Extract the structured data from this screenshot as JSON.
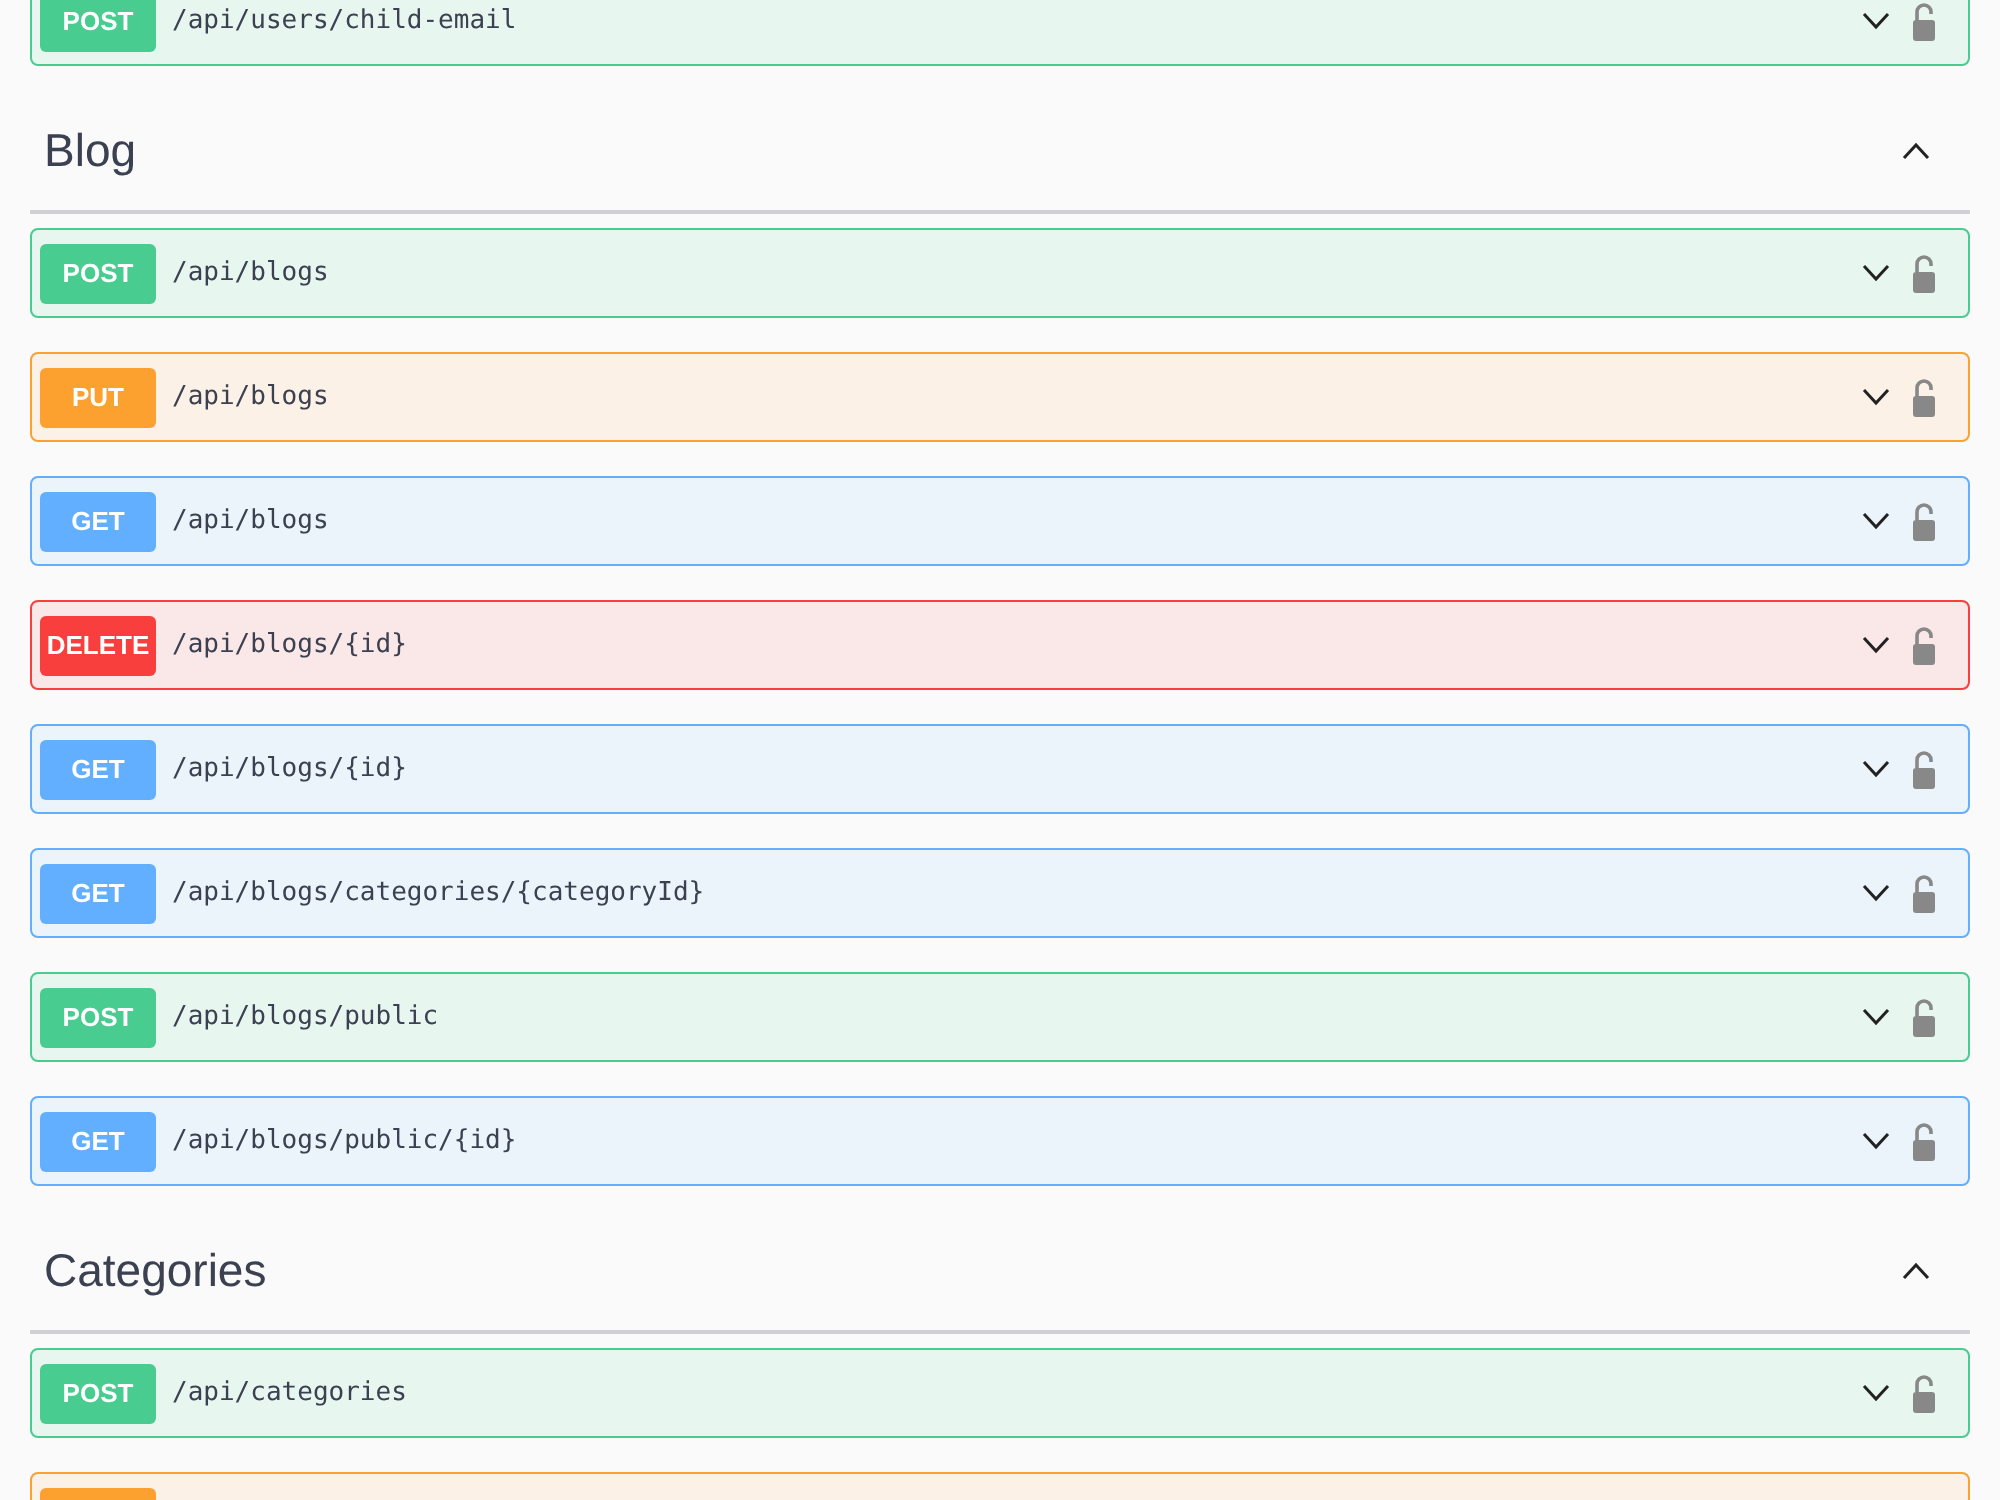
{
  "leading_operations": [
    {
      "kind": "post",
      "method": "POST",
      "path": "/api/users/child-email",
      "expanded": false
    }
  ],
  "sections": [
    {
      "title": "Blog",
      "expanded": true,
      "operations": [
        {
          "kind": "post",
          "method": "POST",
          "path": "/api/blogs",
          "expanded": false
        },
        {
          "kind": "put",
          "method": "PUT",
          "path": "/api/blogs",
          "expanded": false
        },
        {
          "kind": "get",
          "method": "GET",
          "path": "/api/blogs",
          "expanded": false
        },
        {
          "kind": "delete",
          "method": "DELETE",
          "path": "/api/blogs/{id}",
          "expanded": false
        },
        {
          "kind": "get",
          "method": "GET",
          "path": "/api/blogs/{id}",
          "expanded": false
        },
        {
          "kind": "get",
          "method": "GET",
          "path": "/api/blogs/categories/{categoryId}",
          "expanded": false
        },
        {
          "kind": "post",
          "method": "POST",
          "path": "/api/blogs/public",
          "expanded": false
        },
        {
          "kind": "get",
          "method": "GET",
          "path": "/api/blogs/public/{id}",
          "expanded": false
        }
      ]
    },
    {
      "title": "Categories",
      "expanded": true,
      "operations": [
        {
          "kind": "post",
          "method": "POST",
          "path": "/api/categories",
          "expanded": false
        },
        {
          "kind": "put"
        }
      ]
    }
  ]
}
